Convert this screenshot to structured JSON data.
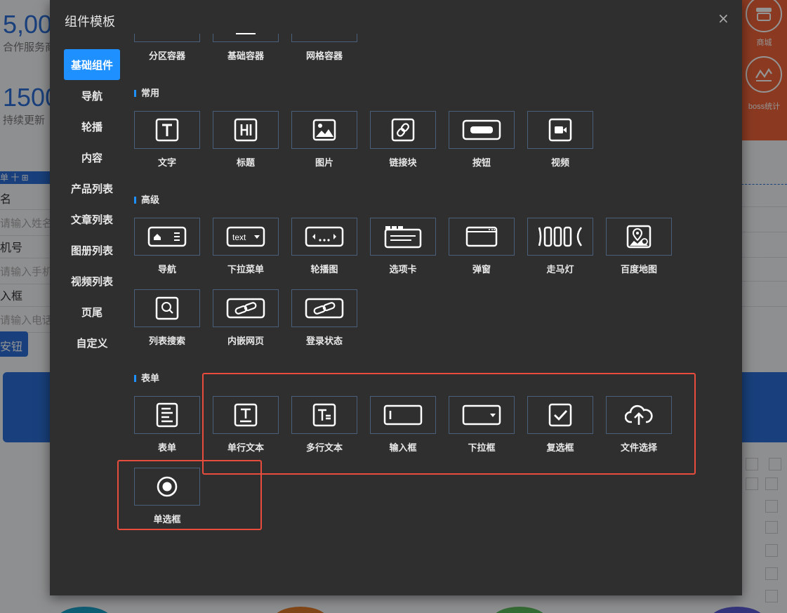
{
  "background": {
    "stats": [
      {
        "number": "5,00",
        "sub": "合作服务商"
      },
      {
        "number": "1500",
        "sub": "持续更新"
      }
    ],
    "right_menu": [
      {
        "label": "商城",
        "icon": "shop-icon"
      },
      {
        "label": "boss统计",
        "icon": "stats-icon"
      }
    ],
    "toolbar_text": "单 十 ⊞",
    "form_lines": [
      "名",
      "请输入姓名",
      "机号",
      "请输入手机",
      "入框",
      "请输入电话"
    ],
    "button_label": "安钮"
  },
  "modal": {
    "title": "组件模板",
    "close_icon": "×",
    "side_menu": [
      {
        "label": "基础组件",
        "active": true
      },
      {
        "label": "导航"
      },
      {
        "label": "轮播"
      },
      {
        "label": "内容"
      },
      {
        "label": "产品列表"
      },
      {
        "label": "文章列表"
      },
      {
        "label": "图册列表"
      },
      {
        "label": "视频列表"
      },
      {
        "label": "页尾"
      },
      {
        "label": "自定义"
      }
    ],
    "containers": [
      {
        "label": "分区容器"
      },
      {
        "label": "基础容器"
      },
      {
        "label": "网格容器"
      }
    ],
    "sections": {
      "common": {
        "title": "常用",
        "items": [
          {
            "label": "文字",
            "icon": "text-icon"
          },
          {
            "label": "标题",
            "icon": "heading-icon"
          },
          {
            "label": "图片",
            "icon": "image-icon"
          },
          {
            "label": "链接块",
            "icon": "link-icon"
          },
          {
            "label": "按钮",
            "icon": "button-icon"
          },
          {
            "label": "视频",
            "icon": "video-icon"
          }
        ]
      },
      "advanced": {
        "title": "高级",
        "items": [
          {
            "label": "导航",
            "icon": "nav-icon"
          },
          {
            "label": "下拉菜单",
            "icon": "dropdown-menu-icon",
            "icon_text": "text"
          },
          {
            "label": "轮播图",
            "icon": "carousel-icon"
          },
          {
            "label": "选项卡",
            "icon": "tabs-icon"
          },
          {
            "label": "弹窗",
            "icon": "popup-icon"
          },
          {
            "label": "走马灯",
            "icon": "marquee-icon"
          },
          {
            "label": "百度地图",
            "icon": "map-icon"
          },
          {
            "label": "列表搜索",
            "icon": "list-search-icon"
          },
          {
            "label": "内嵌网页",
            "icon": "iframe-icon"
          },
          {
            "label": "登录状态",
            "icon": "login-status-icon"
          }
        ]
      },
      "form": {
        "title": "表单",
        "items": [
          {
            "label": "表单",
            "icon": "form-icon"
          },
          {
            "label": "单行文本",
            "icon": "single-line-text-icon"
          },
          {
            "label": "多行文本",
            "icon": "multi-line-text-icon"
          },
          {
            "label": "输入框",
            "icon": "input-icon"
          },
          {
            "label": "下拉框",
            "icon": "select-icon"
          },
          {
            "label": "复选框",
            "icon": "checkbox-icon"
          },
          {
            "label": "文件选择",
            "icon": "file-upload-icon"
          },
          {
            "label": "单选框",
            "icon": "radio-icon"
          }
        ]
      }
    }
  },
  "colors": {
    "modal_bg": "#2f2f2f",
    "accent": "#1e90ff",
    "tile_border": "#4a5f7a",
    "highlight": "#e74c3c",
    "orange": "#f0653a",
    "blue": "#2c6fd6"
  }
}
